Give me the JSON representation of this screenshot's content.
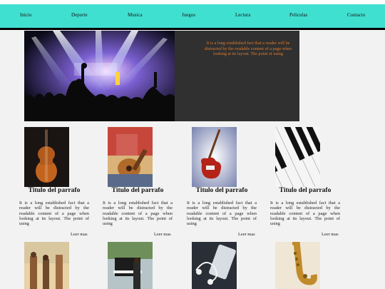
{
  "nav": {
    "items": [
      "Inicio",
      "Deporte",
      "Musica",
      "Juegos",
      "Lectura",
      "Peliculas",
      "Contacto"
    ]
  },
  "hero": {
    "text": "It is a long established fact that a reader will be distracted by the readable content of a page when looking at its layout. The point of using"
  },
  "cards": [
    {
      "title": "Titulo del parrafo",
      "text": "It is a long established fact that a reader will be distracted by the readable content of a page when looking at its layout. The point of using",
      "more": "Leer mas",
      "icon": "cello-image"
    },
    {
      "title": "Titulo del parrafo",
      "text": "It is a long established fact that a reader will be distracted by the readable content of a page when looking at its layout. The point of using",
      "more": "Leer mas",
      "icon": "acoustic-guitar-image"
    },
    {
      "title": "Titulo del parrafo",
      "text": "It is a long established fact that a reader will be distracted by the readable content of a page when looking at its layout. The point of using",
      "more": "Leer mas",
      "icon": "electric-guitar-image"
    },
    {
      "title": "Titulo del parrafo",
      "text": "It is a long established fact that a reader will be distracted by the readable content of a page when looking at its layout. The point of using",
      "more": "Leer mas",
      "icon": "piano-keys-image"
    }
  ],
  "row2": [
    "street-musicians-image",
    "street-piano-image",
    "headphones-phone-image",
    "saxophone-image"
  ],
  "colors": {
    "nav_bg": "#40e0d0",
    "hero_box": "#303030",
    "hero_text": "#e07a2a",
    "page_bg": "#f2f2f2"
  }
}
